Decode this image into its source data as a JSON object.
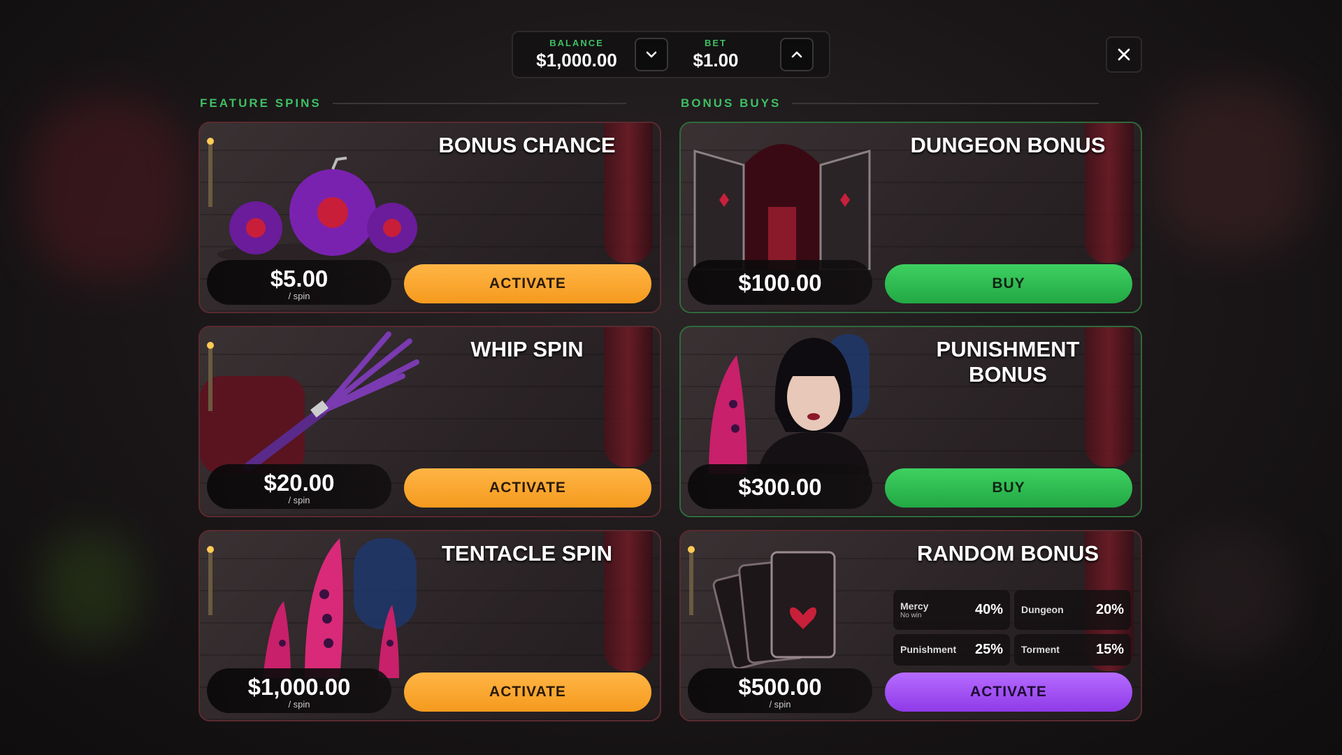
{
  "topbar": {
    "balance_label": "BALANCE",
    "balance_value": "$1,000.00",
    "bet_label": "BET",
    "bet_value": "$1.00"
  },
  "sections": {
    "feature_spins": "FEATURE SPINS",
    "bonus_buys": "BONUS BUYS"
  },
  "feature_spins": [
    {
      "title": "BONUS CHANCE",
      "price": "$5.00",
      "per": "/ spin",
      "button": "ACTIVATE"
    },
    {
      "title": "WHIP SPIN",
      "price": "$20.00",
      "per": "/ spin",
      "button": "ACTIVATE"
    },
    {
      "title": "TENTACLE SPIN",
      "price": "$1,000.00",
      "per": "/ spin",
      "button": "ACTIVATE"
    }
  ],
  "bonus_buys": [
    {
      "title": "DUNGEON BONUS",
      "price": "$100.00",
      "button": "BUY"
    },
    {
      "title": "PUNISHMENT BONUS",
      "price": "$300.00",
      "button": "BUY"
    },
    {
      "title": "RANDOM BONUS",
      "price": "$500.00",
      "per": "/ spin",
      "button": "ACTIVATE",
      "odds": [
        {
          "name": "Mercy",
          "sub": "No win",
          "pct": "40%"
        },
        {
          "name": "Dungeon",
          "pct": "20%"
        },
        {
          "name": "Punishment",
          "pct": "25%"
        },
        {
          "name": "Torment",
          "pct": "15%"
        }
      ]
    }
  ],
  "colors": {
    "accent_green": "#3fbf63",
    "activate_orange": "#f59a1e",
    "buy_green": "#22a844",
    "random_purple": "#8f3ae8"
  },
  "icons": {
    "decrease": "chevron-down-icon",
    "increase": "chevron-up-icon",
    "close": "close-icon"
  }
}
